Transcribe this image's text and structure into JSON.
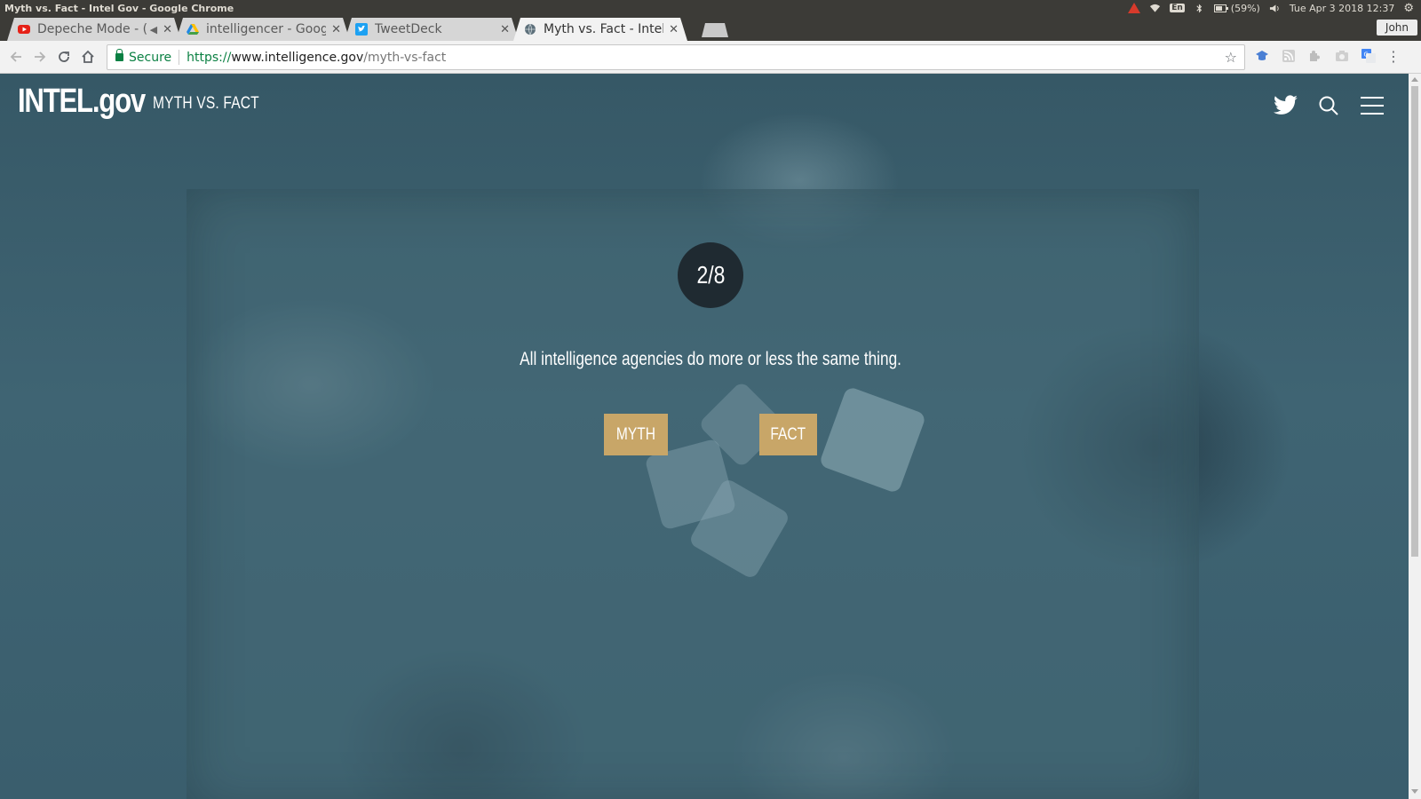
{
  "os": {
    "window_title": "Myth vs. Fact - Intel Gov - Google Chrome",
    "keyboard": "En",
    "battery": "(59%)",
    "datetime": "Tue Apr  3 2018 12:37"
  },
  "browser": {
    "tabs": [
      {
        "label": "Depeche Mode - (",
        "icon": "youtube-icon",
        "muted": true
      },
      {
        "label": "intelligencer - Goog",
        "icon": "google-drive-icon"
      },
      {
        "label": "TweetDeck",
        "icon": "twitter-icon"
      },
      {
        "label": "Myth vs. Fact - Intel",
        "icon": "globe-icon",
        "active": true
      }
    ],
    "user": "John",
    "secure_label": "Secure",
    "url_scheme": "https://",
    "url_host": "www.intelligence.gov",
    "url_path": "/myth-vs-fact"
  },
  "site": {
    "brand": "INTEL.gov",
    "section": "MYTH VS. FACT"
  },
  "quiz": {
    "counter": "2/8",
    "question": "All intelligence agencies do more or less the same thing.",
    "myth_label": "MYTH",
    "fact_label": "FACT",
    "button_color": "#c8a668"
  }
}
